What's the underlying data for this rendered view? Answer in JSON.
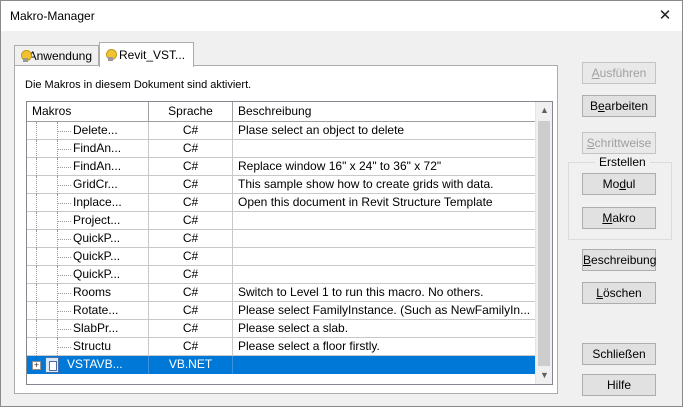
{
  "window": {
    "title": "Makro-Manager",
    "close_glyph": "✕"
  },
  "tabs": [
    {
      "label": "Anwendung",
      "icon": "bulb-icon"
    },
    {
      "label": "Revit_VST...",
      "icon": "bulb-icon"
    }
  ],
  "panel": {
    "info": "Die Makros in diesem Dokument sind aktiviert."
  },
  "grid": {
    "headers": {
      "makros": "Makros",
      "sprache": "Sprache",
      "beschreibung": "Beschreibung"
    },
    "rows": [
      {
        "name": "Delete...",
        "lang": "C#",
        "desc": "Plase select an object to delete"
      },
      {
        "name": "FindAn...",
        "lang": "C#",
        "desc": ""
      },
      {
        "name": "FindAn...",
        "lang": "C#",
        "desc": "Replace window 16\" x 24\" to 36\" x 72\""
      },
      {
        "name": "GridCr...",
        "lang": "C#",
        "desc": "This sample show how to create grids with data."
      },
      {
        "name": "Inplace...",
        "lang": "C#",
        "desc": "Open this document in Revit Structure Template"
      },
      {
        "name": "Project...",
        "lang": "C#",
        "desc": ""
      },
      {
        "name": "QuickP...",
        "lang": "C#",
        "desc": ""
      },
      {
        "name": "QuickP...",
        "lang": "C#",
        "desc": ""
      },
      {
        "name": "QuickP...",
        "lang": "C#",
        "desc": ""
      },
      {
        "name": "Rooms",
        "lang": "C#",
        "desc": "Switch to Level 1 to run this macro. No others."
      },
      {
        "name": "Rotate...",
        "lang": "C#",
        "desc": "Please select FamilyInstance. (Such as NewFamilyIn..."
      },
      {
        "name": "SlabPr...",
        "lang": "C#",
        "desc": "Please select a slab."
      },
      {
        "name": "Structu",
        "lang": "C#",
        "desc": "Please select a floor firstly."
      }
    ],
    "selected_row": {
      "name": "VSTAVB...",
      "lang": "VB.NET",
      "desc": "",
      "expander": "+"
    },
    "scroll_up": "▲",
    "scroll_down": "▼"
  },
  "buttons": {
    "ausfuehren": {
      "pre": "",
      "u": "A",
      "post": "usführen"
    },
    "bearbeiten": {
      "pre": "B",
      "u": "e",
      "post": "arbeiten"
    },
    "schrittweise": {
      "pre": "",
      "u": "S",
      "post": "chrittweise"
    },
    "erstellen_label": "Erstellen",
    "modul": {
      "pre": "Mo",
      "u": "d",
      "post": "ul"
    },
    "makro": {
      "pre": "",
      "u": "M",
      "post": "akro"
    },
    "beschreibung": {
      "pre": "",
      "u": "B",
      "post": "eschreibung"
    },
    "loeschen": {
      "pre": "",
      "u": "L",
      "post": "öschen"
    },
    "schliessen": "Schließen",
    "hilfe": "Hilfe"
  }
}
